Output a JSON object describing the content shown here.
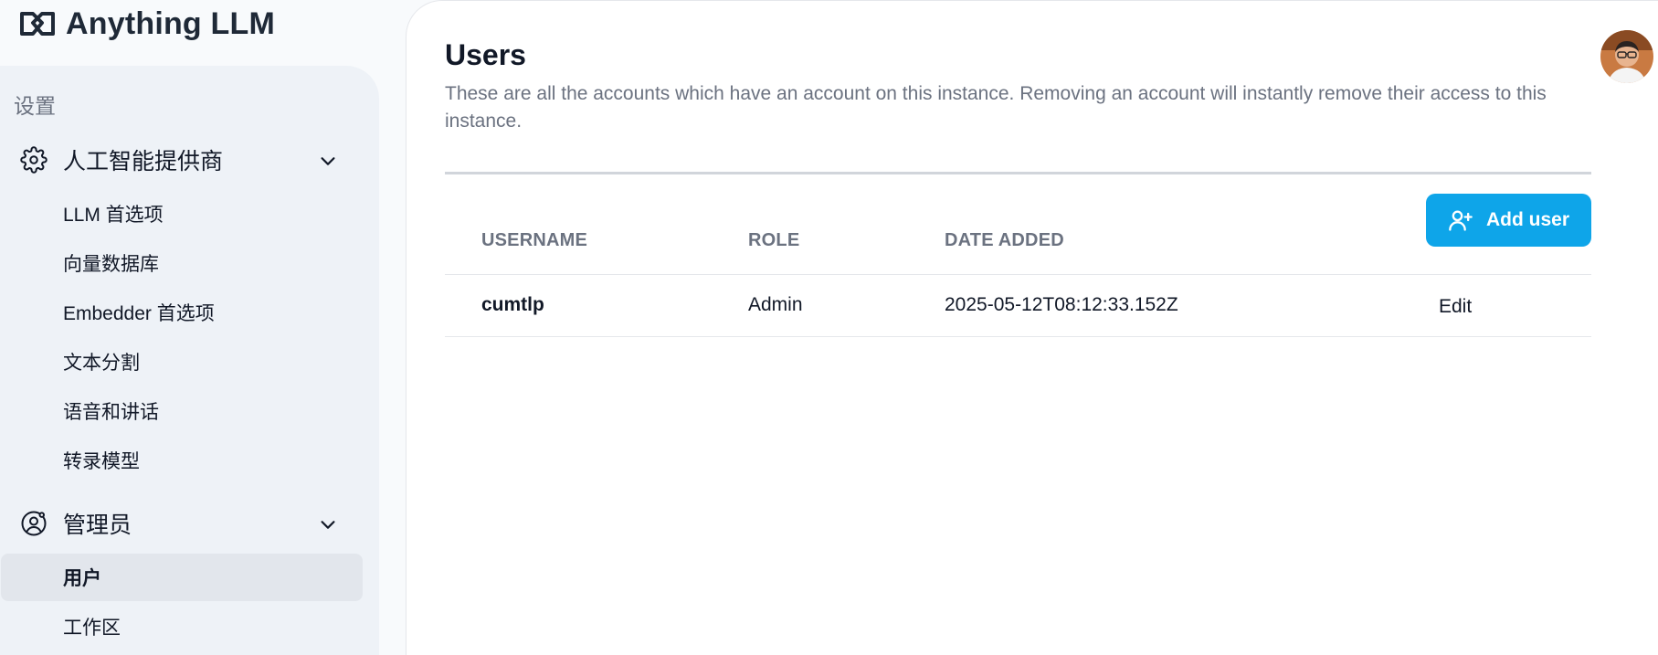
{
  "brand": {
    "name": "Anything LLM"
  },
  "sidebar": {
    "heading": "设置",
    "groups": [
      {
        "label": "人工智能提供商",
        "icon": "gear-icon",
        "items": [
          {
            "label": "LLM 首选项"
          },
          {
            "label": "向量数据库"
          },
          {
            "label": "Embedder 首选项"
          },
          {
            "label": "文本分割"
          },
          {
            "label": "语音和讲话"
          },
          {
            "label": "转录模型"
          }
        ]
      },
      {
        "label": "管理员",
        "icon": "user-gear-icon",
        "items": [
          {
            "label": "用户",
            "active": true
          },
          {
            "label": "工作区"
          }
        ]
      }
    ]
  },
  "main": {
    "title": "Users",
    "description": "These are all the accounts which have an account on this instance. Removing an account will instantly remove their access to this instance.",
    "add_user_label": "Add user",
    "table": {
      "headers": [
        "USERNAME",
        "ROLE",
        "DATE ADDED"
      ],
      "rows": [
        {
          "username": "cumtlp",
          "role": "Admin",
          "date_added": "2025-05-12T08:12:33.152Z",
          "action": "Edit"
        }
      ]
    }
  },
  "colors": {
    "accent": "#0ea5e9",
    "sidebar_bg": "#eef2f7",
    "active_item_bg": "#e2e6ec"
  }
}
